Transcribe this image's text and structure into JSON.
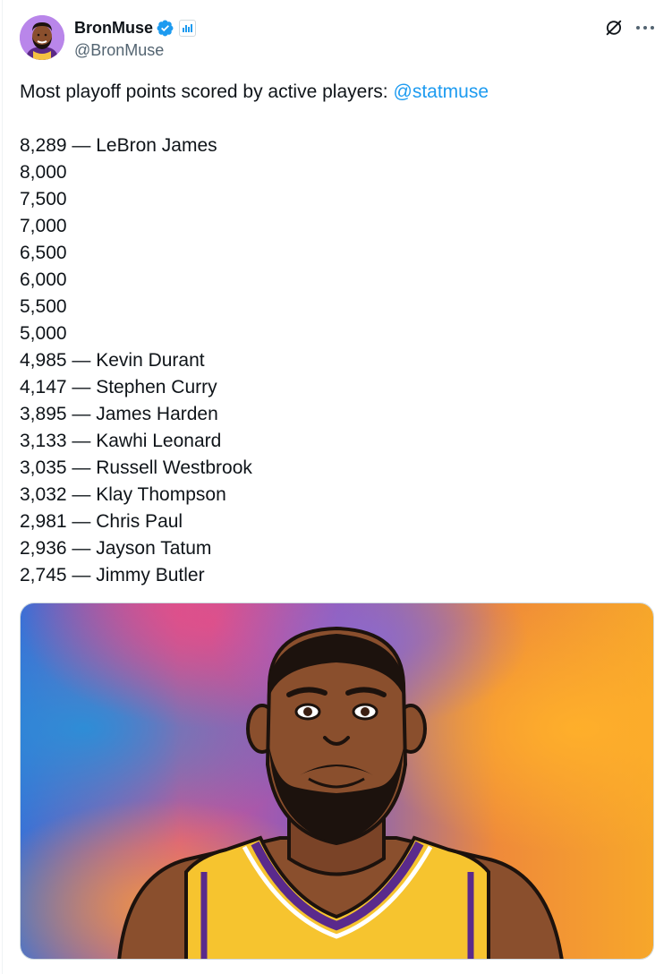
{
  "tweet": {
    "author": {
      "display_name": "BronMuse",
      "handle": "@BronMuse",
      "verified": true,
      "verified_color": "#1d9bf0"
    },
    "text": {
      "intro": "Most playoff points scored by active players:",
      "mention": "@statmuse",
      "lines": [
        "8,289 — LeBron James",
        "8,000",
        "7,500",
        "7,000",
        "6,500",
        "6,000",
        "5,500",
        "5,000",
        "4,985 — Kevin Durant",
        "4,147 — Stephen Curry",
        "3,895 — James Harden",
        "3,133 — Kawhi Leonard",
        "3,035 — Russell Westbrook",
        "3,032 — Klay Thompson",
        "2,981 — Chris Paul",
        "2,936 — Jayson Tatum",
        "2,745 — Jimmy Butler"
      ]
    },
    "icons": {
      "grok": "grok-icon",
      "more": "more-options-icon",
      "affiliate": "affiliate-badge-icon"
    },
    "media": {
      "type": "illustration"
    },
    "colors": {
      "text": "#0f1419",
      "secondary": "#536471",
      "link": "#1d9bf0",
      "border": "#cfd9de"
    }
  }
}
